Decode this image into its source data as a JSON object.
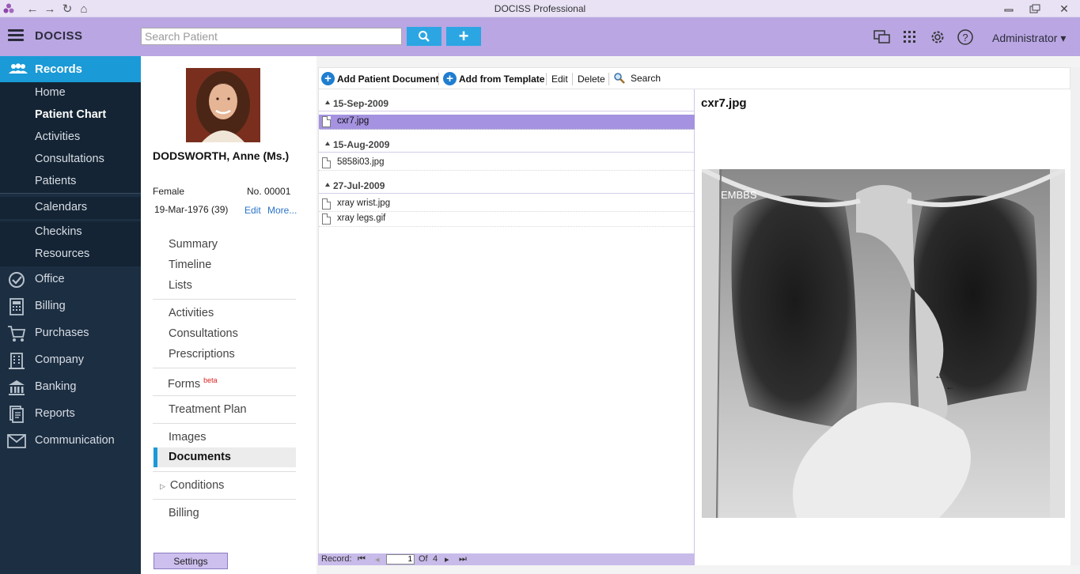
{
  "window": {
    "title": "DOCISS Professional",
    "controls": {
      "minimize": "▭",
      "restore": "❐",
      "close": "✕"
    }
  },
  "header": {
    "app_name": "DOCISS",
    "search_placeholder": "Search Patient",
    "user": "Administrator ▾"
  },
  "sidebar": {
    "records_label": "Records",
    "record_items": [
      "Home",
      "Patient Chart",
      "Activities",
      "Consultations",
      "Patients"
    ],
    "schedule_items": [
      "Calendars",
      "Checkins",
      "Resources"
    ],
    "modules": [
      {
        "label": "Office",
        "icon": "check-circle-icon"
      },
      {
        "label": "Billing",
        "icon": "calculator-icon"
      },
      {
        "label": "Purchases",
        "icon": "cart-icon"
      },
      {
        "label": "Company",
        "icon": "building-icon"
      },
      {
        "label": "Banking",
        "icon": "bank-icon"
      },
      {
        "label": "Reports",
        "icon": "report-icon"
      },
      {
        "label": "Communication",
        "icon": "mail-icon"
      }
    ]
  },
  "patient": {
    "name": "DODSWORTH, Anne (Ms.)",
    "gender": "Female",
    "number": "No. 00001",
    "dob": "19-Mar-1976 (39)",
    "edit_link": "Edit",
    "more_link": "More...",
    "nav": {
      "summary": "Summary",
      "timeline": "Timeline",
      "lists": "Lists",
      "activities": "Activities",
      "consultations": "Consultations",
      "prescriptions": "Prescriptions",
      "forms": "Forms",
      "forms_badge": "beta",
      "treatment_plan": "Treatment Plan",
      "images": "Images",
      "documents": "Documents",
      "conditions": "Conditions",
      "billing": "Billing"
    },
    "settings": "Settings"
  },
  "toolbar": {
    "add_document": "Add Patient Document",
    "add_template": "Add from Template",
    "edit": "Edit",
    "delete": "Delete",
    "search": "Search"
  },
  "documents": {
    "groups": [
      {
        "date": "15-Sep-2009",
        "files": [
          "cxr7.jpg"
        ]
      },
      {
        "date": "15-Aug-2009",
        "files": [
          "5858i03.jpg"
        ]
      },
      {
        "date": "27-Jul-2009",
        "files": [
          "xray wrist.jpg",
          "xray legs.gif"
        ]
      }
    ],
    "selected": "cxr7.jpg"
  },
  "pager": {
    "record_label": "Record:",
    "current": "1",
    "of_label": "Of",
    "total": "4"
  },
  "preview": {
    "filename": "cxr7.jpg",
    "image_label": "EMBBS"
  }
}
